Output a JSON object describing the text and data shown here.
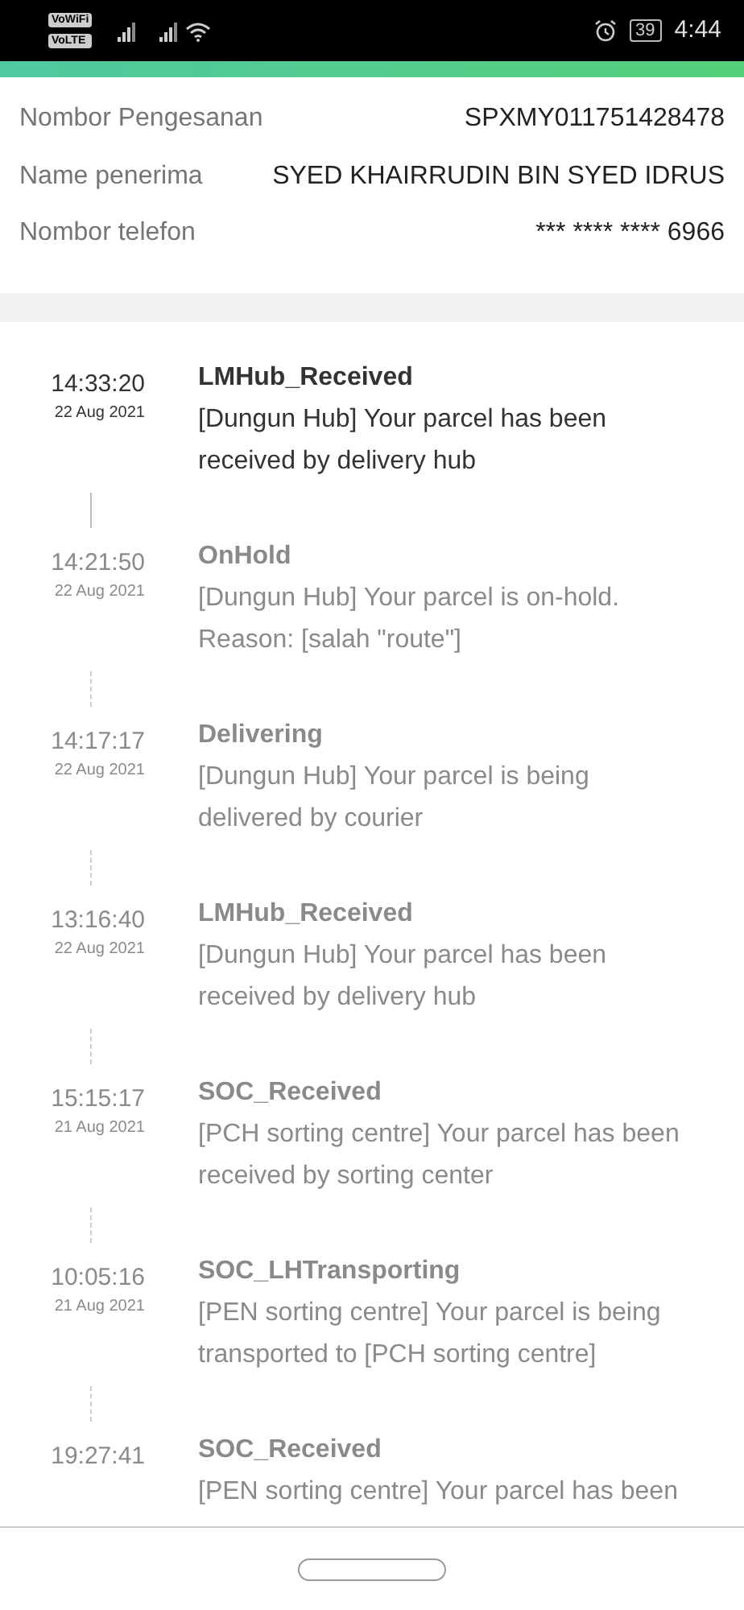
{
  "status_bar": {
    "network_labels": [
      "VoWiFi",
      "VoLTE"
    ],
    "battery": "39",
    "time": "4:44"
  },
  "order_info": [
    {
      "label": "Nombor Pengesanan",
      "value": "SPXMY011751428478"
    },
    {
      "label": "Name penerima",
      "value": "SYED KHAIRRUDIN BIN SYED IDRUS"
    },
    {
      "label": "Nombor telefon",
      "value": "*** **** **** 6966"
    }
  ],
  "timeline": [
    {
      "time": "14:33:20",
      "date": "22 Aug 2021",
      "status": "LMHub_Received",
      "description": "[Dungun Hub] Your parcel has been received by delivery hub",
      "current": true
    },
    {
      "time": "14:21:50",
      "date": "22 Aug 2021",
      "status": "OnHold",
      "description": "[Dungun Hub] Your parcel is on-hold. Reason: [salah \"route\"]",
      "current": false
    },
    {
      "time": "14:17:17",
      "date": "22 Aug 2021",
      "status": "Delivering",
      "description": "[Dungun Hub] Your parcel is being delivered by courier",
      "current": false
    },
    {
      "time": "13:16:40",
      "date": "22 Aug 2021",
      "status": "LMHub_Received",
      "description": "[Dungun Hub] Your parcel has been received by delivery hub",
      "current": false
    },
    {
      "time": "15:15:17",
      "date": "21 Aug 2021",
      "status": "SOC_Received",
      "description": "[PCH sorting centre] Your parcel has been received by sorting center",
      "current": false
    },
    {
      "time": "10:05:16",
      "date": "21 Aug 2021",
      "status": "SOC_LHTransporting",
      "description": "[PEN sorting centre] Your parcel is being transported to [PCH sorting centre]",
      "current": false
    },
    {
      "time": "19:27:41",
      "status": "SOC_Received",
      "description": "[PEN sorting centre] Your parcel has been",
      "current": false
    }
  ]
}
